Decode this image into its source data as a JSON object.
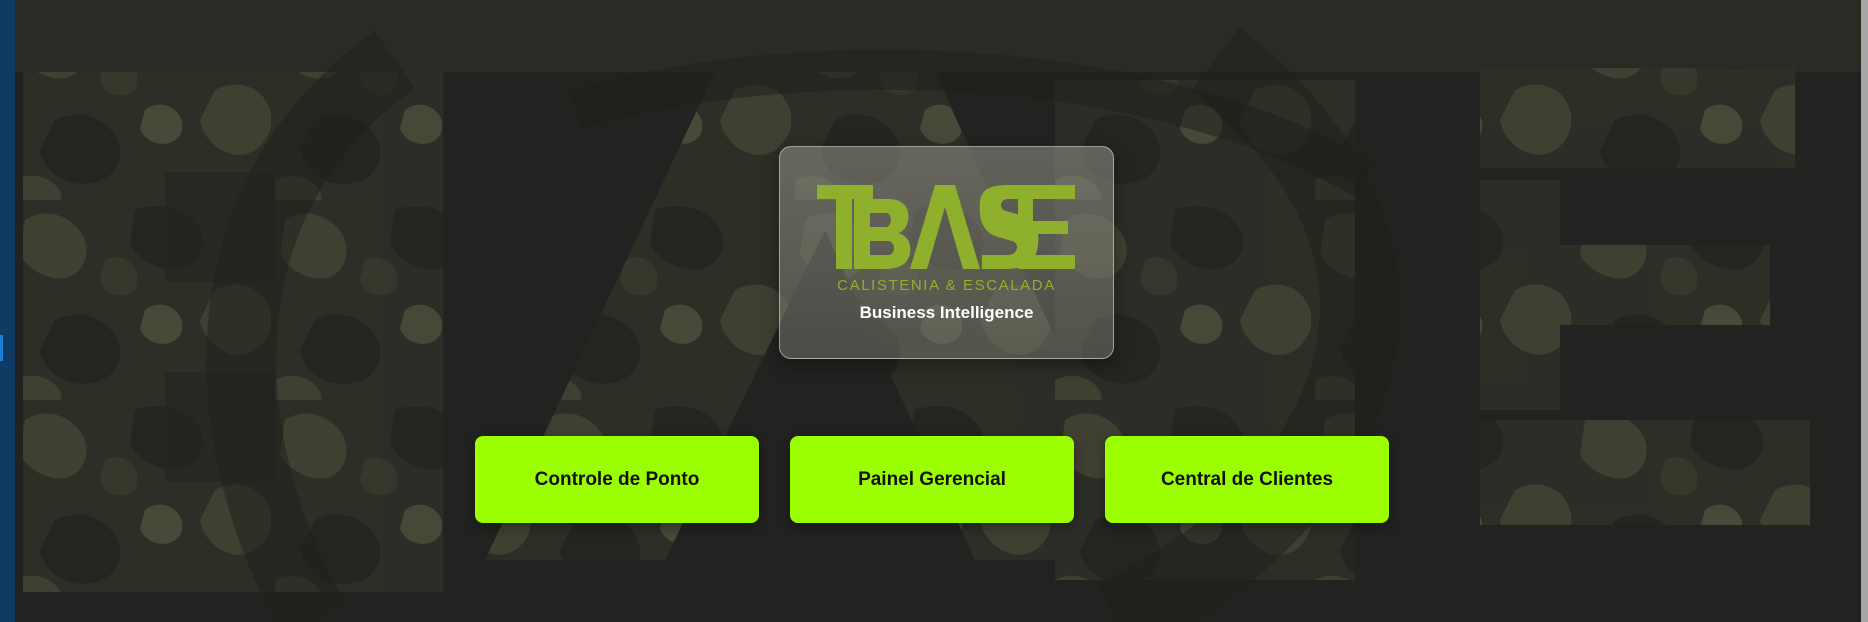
{
  "brand": {
    "logo_text": "BASE",
    "subtitle": "CALISTENIA & ESCALADA",
    "tagline": "Business Intelligence",
    "accent_color": "#9cff00",
    "logo_color": "#8fb02c"
  },
  "buttons": [
    {
      "label": "Controle de Ponto"
    },
    {
      "label": "Painel Gerencial"
    },
    {
      "label": "Central de Clientes"
    }
  ],
  "background": {
    "description_color": "#262624"
  }
}
